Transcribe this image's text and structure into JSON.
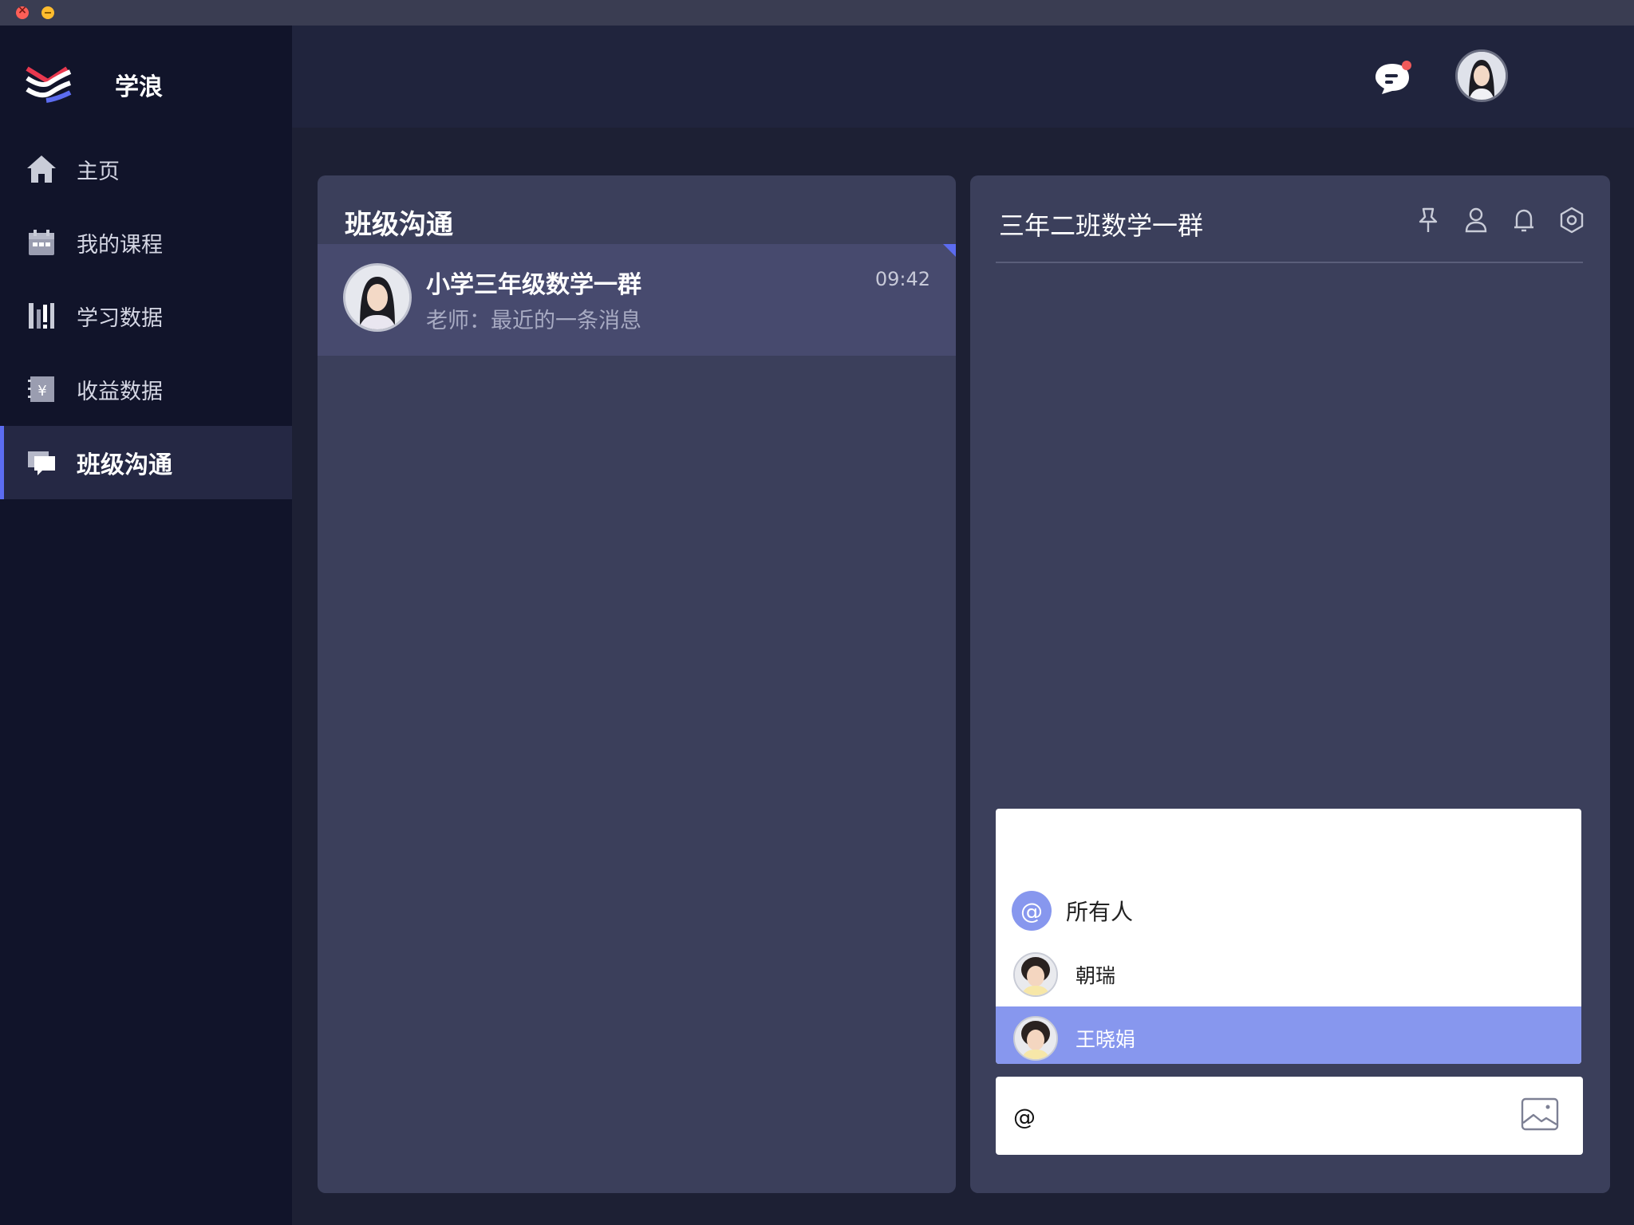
{
  "app": {
    "name": "学浪"
  },
  "nav": {
    "items": [
      {
        "label": "主页",
        "icon": "home-icon"
      },
      {
        "label": "我的课程",
        "icon": "calendar-icon"
      },
      {
        "label": "学习数据",
        "icon": "bar-chart-icon"
      },
      {
        "label": "收益数据",
        "icon": "yuan-icon"
      },
      {
        "label": "班级沟通",
        "icon": "chat-icon",
        "active": true
      }
    ]
  },
  "conversations": {
    "title": "班级沟通",
    "items": [
      {
        "name": "小学三年级数学一群",
        "last_message": "老师：最近的一条消息",
        "time": "09:42"
      }
    ]
  },
  "chat": {
    "title": "三年二班数学一群",
    "tools": [
      "pin-icon",
      "member-icon",
      "bell-icon",
      "settings-icon"
    ],
    "mention": {
      "all_symbol": "@",
      "all_label": "所有人",
      "members": [
        {
          "name": "朝瑞"
        },
        {
          "name": "王晓娟",
          "highlighted": true
        }
      ]
    },
    "input": {
      "value": "@"
    }
  },
  "colors": {
    "accent": "#5c6cf0",
    "highlight": "#8797ee",
    "notification_dot": "#f05a5a",
    "sidebar_bg": "#11142a",
    "panel_bg": "#3b3f5b"
  }
}
